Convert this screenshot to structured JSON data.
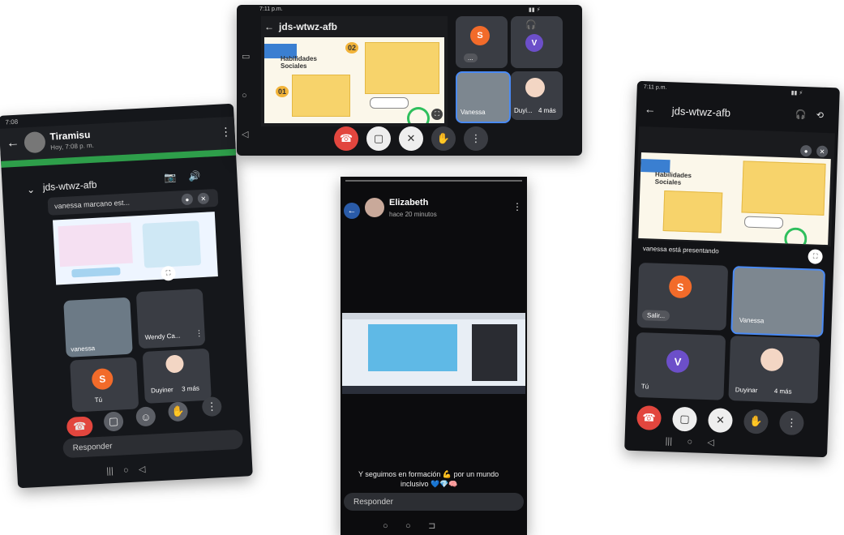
{
  "meeting_code": "jds-wtwz-afb",
  "left_phone": {
    "contact_name": "Tiramisu",
    "contact_time": "Hoy, 7:08 p. m.",
    "presenter_label": "vanessa marcano est...",
    "participants": [
      {
        "name": "vanessa"
      },
      {
        "name": "Wendy Ca..."
      },
      {
        "initial": "S",
        "name": "Tú"
      },
      {
        "name": "Duyiner",
        "extra": "3 más"
      }
    ],
    "reply_label": "Responder"
  },
  "top_tablet": {
    "time": "7:11 p.m.",
    "slide_title": "Habilidades Sociales",
    "num_02": "02",
    "num_01": "01",
    "participants": [
      {
        "initial": "S",
        "label": "..."
      },
      {
        "initial": "V",
        "label": ""
      },
      {
        "name": "Vanessa"
      },
      {
        "name": "Duyi...",
        "extra": "4 más"
      }
    ]
  },
  "center_phone": {
    "contact_name": "Elizabeth",
    "contact_time": "hace 20 minutos",
    "caption_line1": "Y seguimos en formación 💪 por un mundo",
    "caption_line2": "inclusivo 💙💎🧠",
    "reply_label": "Responder"
  },
  "right_phone": {
    "time": "7:11 p.m.",
    "presenter_label": "vanessa está presentando",
    "participants": [
      {
        "initial": "S",
        "label": "Salir..."
      },
      {
        "name": "Vanessa"
      },
      {
        "initial": "V",
        "name": "Tú"
      },
      {
        "name": "Duyinar",
        "extra": "4 más"
      }
    ]
  },
  "colors": {
    "end_call": "#e2463e",
    "accent_orange": "#f26b2a",
    "accent_purple": "#6c4fc9",
    "whatsapp_green": "#2e9e4a"
  }
}
